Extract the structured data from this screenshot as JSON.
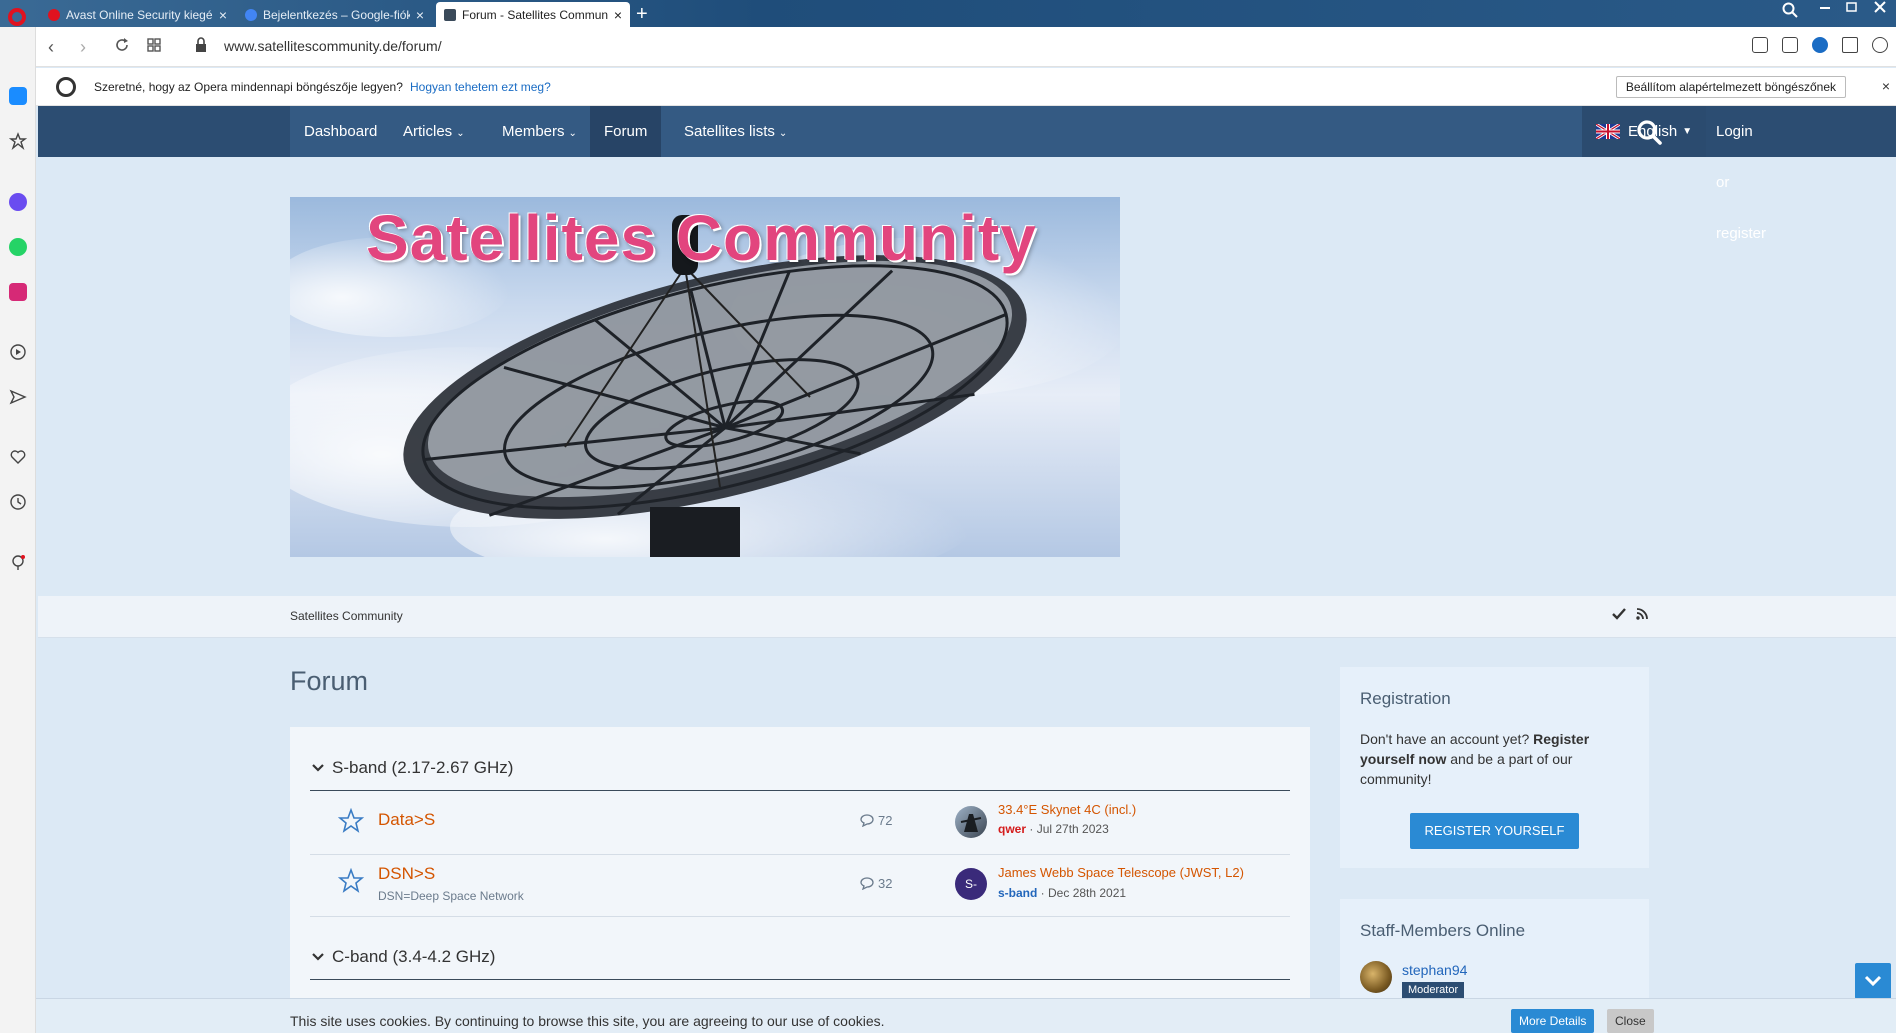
{
  "browser": {
    "tabs": [
      {
        "title": "Avast Online Security kiegé",
        "color": "#e0121f"
      },
      {
        "title": "Bejelentkezés – Google-fiók",
        "color": "#4285f4"
      },
      {
        "title": "Forum - Satellites Commun",
        "color": "#3a4a5a"
      }
    ],
    "new_tab": "+",
    "url": "www.satellitescommunity.de/forum/",
    "infobar": {
      "question": "Szeretné, hogy az Opera mindennapi böngészője legyen?",
      "how_link": "Hogyan tehetem ezt meg?",
      "set_default": "Beállítom alapértelmezett böngészőnek",
      "close": "×"
    }
  },
  "nav": {
    "items": [
      {
        "label": "Dashboard",
        "caret": ""
      },
      {
        "label": "Articles",
        "caret": "⌄"
      },
      {
        "label": "Members",
        "caret": "⌄"
      },
      {
        "label": "Forum",
        "caret": ""
      },
      {
        "label": "Satellites lists",
        "caret": "⌄"
      }
    ],
    "language": "English",
    "login": "Login or register"
  },
  "banner": {
    "title": "Satellites Community"
  },
  "breadcrumb": "Satellites Community",
  "page_title": "Forum",
  "categories": [
    {
      "name": "S-band (2.17-2.67 GHz)",
      "boards": [
        {
          "name": "Data>S",
          "description": "",
          "count": "72",
          "last_title": "33.4°E Skynet 4C (incl.)",
          "last_user": "qwer",
          "last_date": "Jul 27th 2023",
          "avatar_text": ""
        },
        {
          "name": "DSN>S",
          "description": "DSN=Deep Space Network",
          "count": "32",
          "last_title": "James Webb Space Telescope (JWST, L2)",
          "last_user": "s-band",
          "last_date": "Dec 28th 2021",
          "avatar_text": "S-"
        }
      ]
    },
    {
      "name": "C-band (3.4-4.2 GHz)",
      "boards": []
    }
  ],
  "registration": {
    "title": "Registration",
    "text_a": "Don't have an account yet? ",
    "text_b": "Register yourself now",
    "text_c": " and be a part of our community!",
    "button": "REGISTER YOURSELF"
  },
  "staff": {
    "title": "Staff-Members Online",
    "name": "stephan94",
    "role": "Moderator"
  },
  "cookie": {
    "text": "This site uses cookies. By continuing to browse this site, you are agreeing to our use of cookies.",
    "more": "More Details",
    "close": "Close"
  }
}
